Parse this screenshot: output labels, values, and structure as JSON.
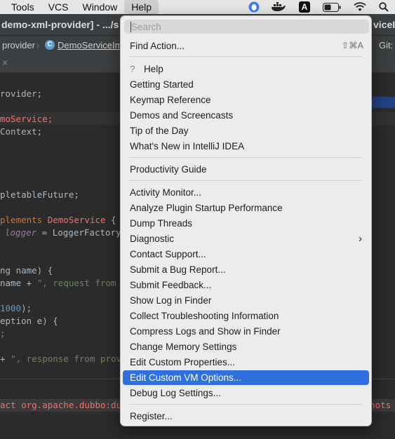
{
  "menubar": {
    "items": [
      "Tools",
      "VCS",
      "Window",
      "Help"
    ],
    "active": "Help"
  },
  "tray": {
    "icons": [
      "qq-icon",
      "docker-icon",
      "input-method-icon",
      "battery-icon",
      "wifi-icon",
      "search-icon"
    ],
    "input_method_letter": "A"
  },
  "titlebar": {
    "text": "demo-xml-provider] - .../s",
    "right_text": "viceI"
  },
  "navbar": {
    "crumb_provider": "provider",
    "crumb_class_badge": "C",
    "crumb_class": "DemoServiceIm",
    "vcs_label": "Git:"
  },
  "tabbar": {
    "close_glyph": "×"
  },
  "editor": {
    "line1": "rovider;",
    "line2": "moService;",
    "line3": "Context;",
    "line4": "pletableFuture;",
    "line5a": "plements ",
    "line5b": "DemoService",
    "line5c": " {",
    "line6a": "logger",
    "line6b": " = LoggerFactory.g",
    "line7": "ng name) {",
    "line8a": "name + ",
    "line8b": "\", request from co",
    "line9a": "1000",
    "line9b": ");",
    "line10": "eption e) {",
    "line11": ";",
    "line12a": "+ ",
    "line12b": "\", response from provic"
  },
  "bottom": {
    "error_text": "act org.apache.dubbo:dub",
    "error_right": "oshots"
  },
  "help_menu": {
    "search_placeholder": "Search",
    "find_action": "Find Action...",
    "find_action_shortcut": "⇧⌘A",
    "help_q": "?",
    "help": "Help",
    "getting_started": "Getting Started",
    "keymap_reference": "Keymap Reference",
    "demos": "Demos and Screencasts",
    "tip_of_day": "Tip of the Day",
    "whats_new": "What's New in IntelliJ IDEA",
    "productivity_guide": "Productivity Guide",
    "activity_monitor": "Activity Monitor...",
    "analyze_plugin": "Analyze Plugin Startup Performance",
    "dump_threads": "Dump Threads",
    "diagnostic": "Diagnostic",
    "contact_support": "Contact Support...",
    "submit_bug": "Submit a Bug Report...",
    "submit_feedback": "Submit Feedback...",
    "show_log": "Show Log in Finder",
    "collect_troubleshooting": "Collect Troubleshooting Information",
    "compress_logs": "Compress Logs and Show in Finder",
    "change_memory": "Change Memory Settings",
    "edit_custom_properties": "Edit Custom Properties...",
    "edit_custom_vm": "Edit Custom VM Options...",
    "debug_log": "Debug Log Settings...",
    "register": "Register..."
  },
  "colors": {
    "selection": "#2f6fde",
    "menu_bg": "#ececec",
    "editor_bg": "#2b2b2b"
  }
}
